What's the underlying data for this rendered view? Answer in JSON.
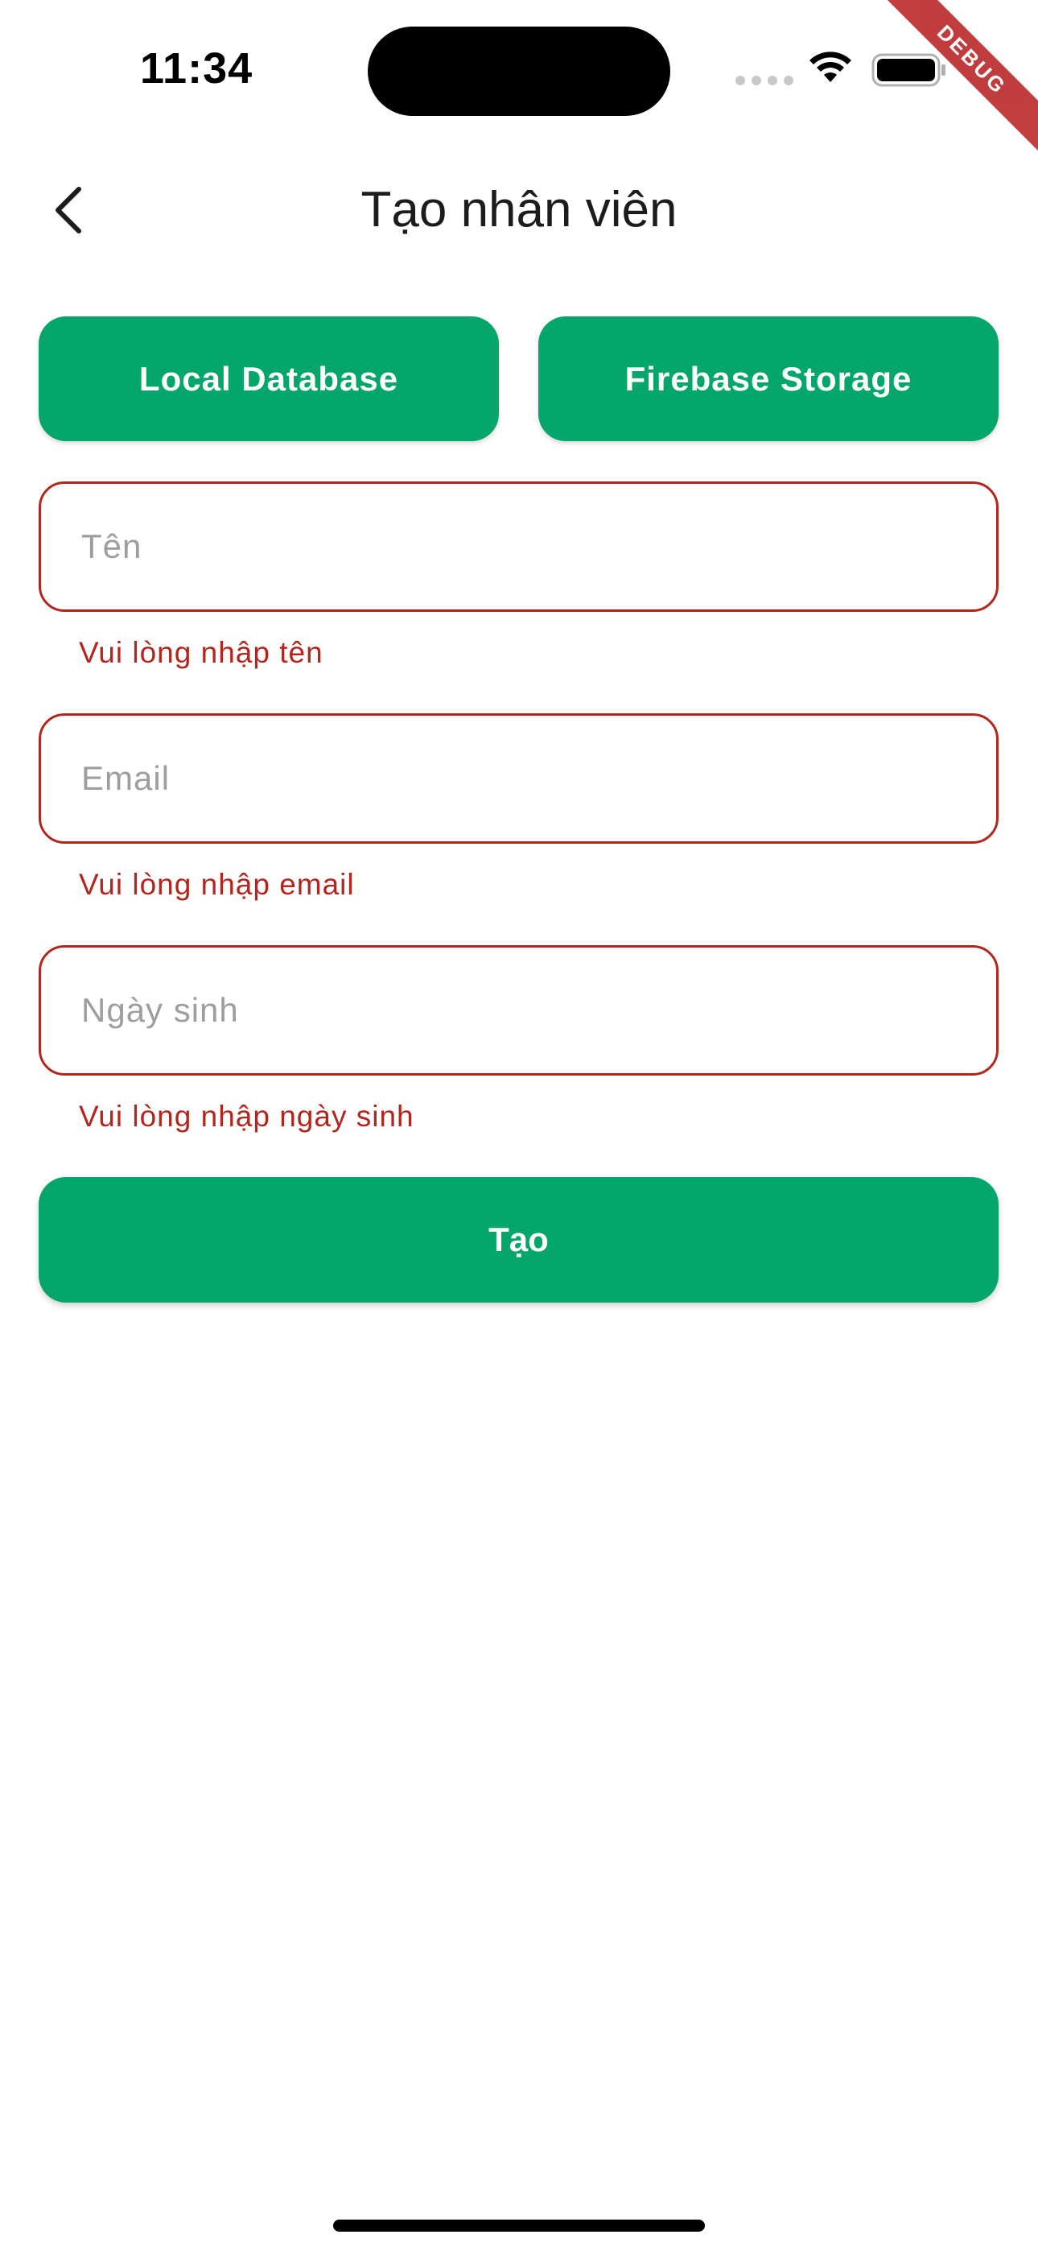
{
  "status_bar": {
    "time": "11:34"
  },
  "debug_banner": "DEBUG",
  "header": {
    "title": "Tạo nhân viên",
    "back_icon": "chevron-left-icon"
  },
  "source_buttons": {
    "local": "Local Database",
    "firebase": "Firebase Storage"
  },
  "form": {
    "name": {
      "placeholder": "Tên",
      "value": "",
      "error": "Vui lòng nhập tên"
    },
    "email": {
      "placeholder": "Email",
      "value": "",
      "error": "Vui lòng nhập email"
    },
    "birthday": {
      "placeholder": "Ngày sinh",
      "value": "",
      "error": "Vui lòng nhập ngày sinh"
    },
    "submit_label": "Tạo"
  },
  "colors": {
    "primary": "#04a66b",
    "error": "#b3261e",
    "placeholder": "#9e9e9e"
  }
}
